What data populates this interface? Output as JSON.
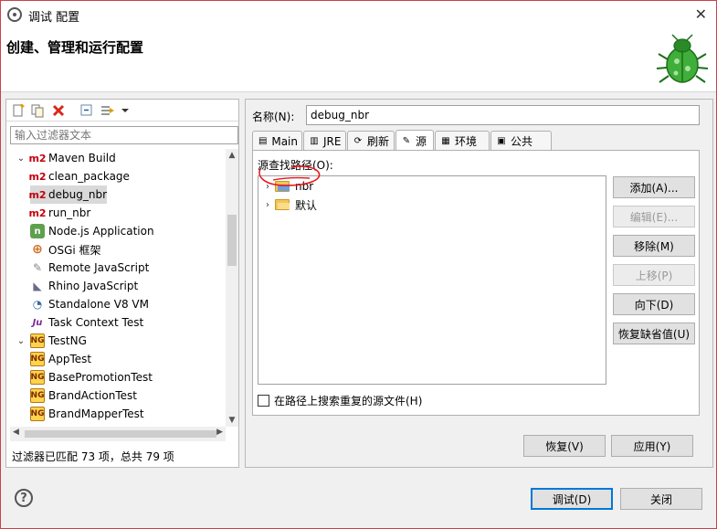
{
  "window": {
    "title": "调试 配置",
    "close_glyph": "✕",
    "heading": "创建、管理和运行配置"
  },
  "left_panel": {
    "filter_placeholder": "输入过滤器文本",
    "tree": [
      {
        "label": "Maven Build",
        "icon": "m2-icon",
        "glyph": "m2",
        "twist": "⌄",
        "level": 0
      },
      {
        "label": "clean_package",
        "icon": "m2-icon",
        "glyph": "m2",
        "twist": "",
        "level": 1
      },
      {
        "label": "debug_nbr",
        "icon": "m2-icon",
        "glyph": "m2",
        "twist": "",
        "level": 1,
        "selected": true
      },
      {
        "label": "run_nbr",
        "icon": "m2-icon",
        "glyph": "m2",
        "twist": "",
        "level": 1
      },
      {
        "label": "Node.js Application",
        "icon": "nodejs-icon",
        "glyph": "n",
        "twist": "",
        "level": 0
      },
      {
        "label": "OSGi 框架",
        "icon": "osgi-icon",
        "glyph": "⊕",
        "twist": "",
        "level": 0
      },
      {
        "label": "Remote JavaScript",
        "icon": "remote-js-icon",
        "glyph": "✎",
        "twist": "",
        "level": 0
      },
      {
        "label": "Rhino JavaScript",
        "icon": "rhino-icon",
        "glyph": "◣",
        "twist": "",
        "level": 0
      },
      {
        "label": "Standalone V8 VM",
        "icon": "v8-icon",
        "glyph": "◔",
        "twist": "",
        "level": 0
      },
      {
        "label": "Task Context Test",
        "icon": "junit-icon",
        "glyph": "Ju",
        "twist": "",
        "level": 0
      },
      {
        "label": "TestNG",
        "icon": "testng-icon",
        "glyph": "NG",
        "twist": "⌄",
        "level": 0
      },
      {
        "label": "AppTest",
        "icon": "testng-icon",
        "glyph": "NG",
        "twist": "",
        "level": 1
      },
      {
        "label": "BasePromotionTest",
        "icon": "testng-icon",
        "glyph": "NG",
        "twist": "",
        "level": 1
      },
      {
        "label": "BrandActionTest",
        "icon": "testng-icon",
        "glyph": "NG",
        "twist": "",
        "level": 1
      },
      {
        "label": "BrandMapperTest",
        "icon": "testng-icon",
        "glyph": "NG",
        "twist": "",
        "level": 1
      }
    ],
    "match_count": "过滤器已匹配 73 项，总共 79 项"
  },
  "right_panel": {
    "name_label": "名称(N):",
    "name_value": "debug_nbr",
    "tabs": [
      {
        "label": "Main",
        "icon": "main-tab-icon",
        "glyph": "▤",
        "active": false
      },
      {
        "label": "JRE",
        "icon": "jre-tab-icon",
        "glyph": "▥",
        "active": false
      },
      {
        "label": "刷新",
        "icon": "refresh-tab-icon",
        "glyph": "⟳",
        "active": false
      },
      {
        "label": "源",
        "icon": "source-tab-icon",
        "glyph": "✎",
        "active": true
      },
      {
        "label": "环境",
        "icon": "environment-tab-icon",
        "glyph": "▦",
        "active": false
      },
      {
        "label": "公共",
        "icon": "common-tab-icon",
        "glyph": "▣",
        "active": false
      }
    ],
    "source_lookup_label": "源查找路径(O):",
    "source_entries": [
      {
        "label": "nbr",
        "twist": "›"
      },
      {
        "label": "默认",
        "twist": "›"
      }
    ],
    "side_buttons": [
      {
        "label": "添加(A)...",
        "enabled": true
      },
      {
        "label": "编辑(E)...",
        "enabled": false
      },
      {
        "label": "移除(M)",
        "enabled": true
      },
      {
        "label": "上移(P)",
        "enabled": false
      },
      {
        "label": "向下(D)",
        "enabled": true
      },
      {
        "label": "恢复缺省值(U)",
        "enabled": true
      }
    ],
    "duplicate_checkbox_label": "在路径上搜索重复的源文件(H)",
    "revert_label": "恢复(V)",
    "apply_label": "应用(Y)"
  },
  "footer": {
    "debug_label": "调试(D)",
    "close_label": "关闭"
  },
  "colors": {
    "accent": "#0078d7",
    "annotation": "#e8141c",
    "selected_row": "#d9d9d9"
  }
}
